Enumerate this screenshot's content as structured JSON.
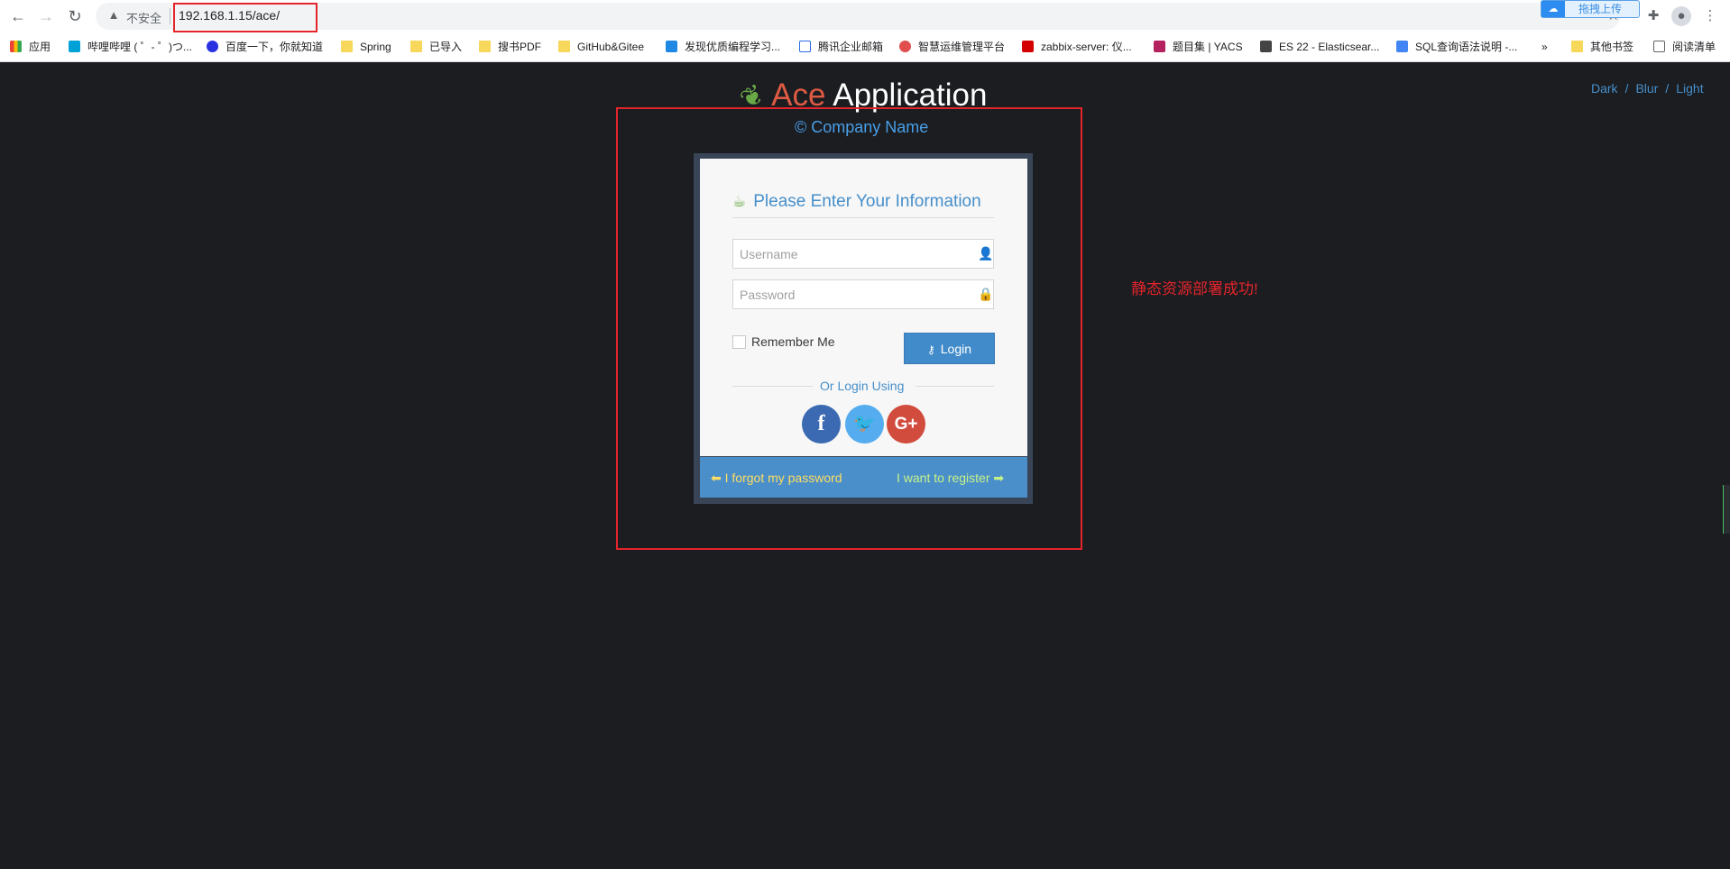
{
  "browser": {
    "security_label": "不安全",
    "url": "192.168.1.15/ace/",
    "upload_label": "拖拽上传",
    "bookmarks": [
      {
        "label": "应用"
      },
      {
        "label": "哔哩哔哩 ( ゜- ゜)つ..."
      },
      {
        "label": "百度一下，你就知道"
      },
      {
        "label": "Spring"
      },
      {
        "label": "已导入"
      },
      {
        "label": "搜书PDF"
      },
      {
        "label": "GitHub&Gitee"
      },
      {
        "label": "发现优质编程学习..."
      },
      {
        "label": "腾讯企业邮箱"
      },
      {
        "label": "智慧运维管理平台"
      },
      {
        "label": "zabbix-server: 仪..."
      },
      {
        "label": "题目集 | YACS"
      },
      {
        "label": "ES 22 - Elasticsear..."
      },
      {
        "label": "SQL查询语法说明 -..."
      },
      {
        "label": "»"
      },
      {
        "label": "其他书签"
      },
      {
        "label": "阅读清单"
      }
    ]
  },
  "page": {
    "brand_ace": "Ace",
    "brand_app": "Application",
    "company": "© Company Name",
    "themes": [
      "Dark",
      "Blur",
      "Light"
    ],
    "theme_separator": "/",
    "annotation": "静态资源部署成功!",
    "login": {
      "title": "Please Enter Your Information",
      "username_placeholder": "Username",
      "password_placeholder": "Password",
      "remember_label": "Remember Me",
      "login_label": "Login",
      "or_label": "Or Login Using",
      "forgot_label": "I forgot my password",
      "register_label": "I want to register"
    }
  },
  "colors": {
    "page_bg": "#1b1d21",
    "brand_ace": "#dd5a43",
    "accent_blue": "#478fca",
    "annotation_red": "#e3242b",
    "facebook": "#3b6ab2",
    "twitter": "#55acee",
    "google_plus": "#d24c3d"
  }
}
